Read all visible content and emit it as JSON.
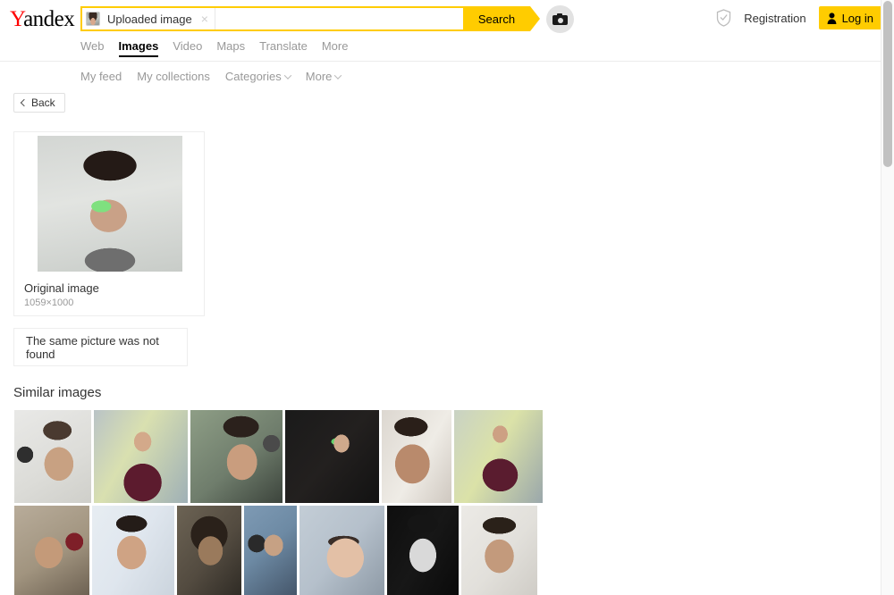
{
  "header": {
    "logo": {
      "first_letter": "Y",
      "rest": "andex"
    },
    "search": {
      "chip_label": "Uploaded image",
      "chip_close": "×",
      "chip_thumb_icon": "uploaded-image-thumbnail",
      "input_value": "",
      "placeholder": "",
      "search_button": "Search",
      "camera_icon": "camera-icon"
    },
    "account": {
      "shield_icon": "shield-check-icon",
      "registration": "Registration",
      "login": "Log in",
      "person_icon": "person-icon"
    },
    "tabs": [
      {
        "label": "Web",
        "active": false
      },
      {
        "label": "Images",
        "active": true
      },
      {
        "label": "Video",
        "active": false
      },
      {
        "label": "Maps",
        "active": false
      },
      {
        "label": "Translate",
        "active": false
      },
      {
        "label": "More",
        "active": false
      }
    ]
  },
  "subnav": [
    {
      "label": "My feed",
      "has_chevron": false
    },
    {
      "label": "My collections",
      "has_chevron": false
    },
    {
      "label": "Categories",
      "has_chevron": true
    },
    {
      "label": "More",
      "has_chevron": true
    }
  ],
  "back_button": {
    "label": "Back",
    "icon": "chevron-left-icon"
  },
  "original": {
    "caption": "Original image",
    "dimensions": "1059×1000"
  },
  "not_found": {
    "message": "The same picture was not found"
  },
  "similar": {
    "title": "Similar images",
    "rows": [
      [
        {
          "id": "t1",
          "alt": "man with headphones looking up"
        },
        {
          "id": "t2",
          "alt": "bearded man in office in maroon sweater"
        },
        {
          "id": "t3",
          "alt": "bearded man with glasses and headphones"
        },
        {
          "id": "t4",
          "alt": "man holding phone in dark room"
        },
        {
          "id": "t5",
          "alt": "close-up of man wearing glasses"
        },
        {
          "id": "t6",
          "alt": "man gesturing in office"
        }
      ],
      [
        {
          "id": "t7",
          "alt": "man with red headphones smiling"
        },
        {
          "id": "t8",
          "alt": "surprised man with glasses and headphones"
        },
        {
          "id": "t9",
          "alt": "long-haired bearded man portrait"
        },
        {
          "id": "t10",
          "alt": "man with headphones at microphone"
        },
        {
          "id": "t11",
          "alt": "close-up man in thick glasses"
        },
        {
          "id": "t12",
          "alt": "black and white portrait of bearded man"
        },
        {
          "id": "t13",
          "alt": "man wearing camera eyewear rig"
        }
      ]
    ]
  },
  "colors": {
    "brand_yellow": "#ffcc00",
    "logo_red": "#ff0000",
    "text_primary": "#333333",
    "text_muted": "#999999",
    "border": "#eeeeee"
  }
}
